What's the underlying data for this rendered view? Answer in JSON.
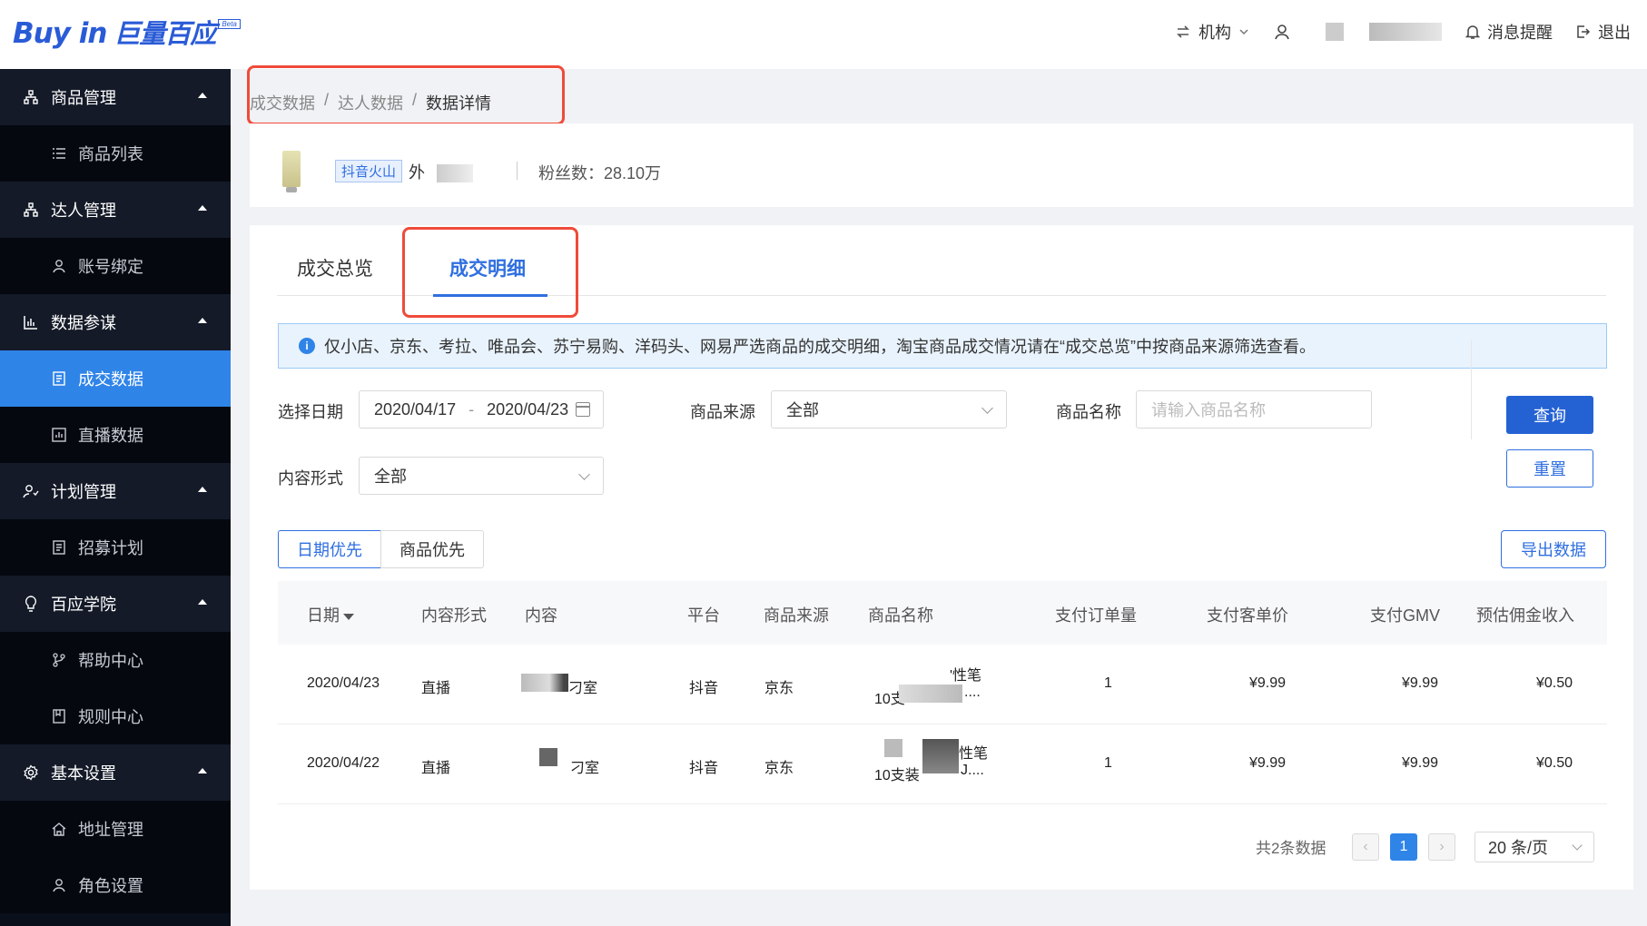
{
  "header": {
    "logo_en": "Buy in",
    "logo_cn": "巨量百应",
    "logo_badge": "Beta",
    "org_label": "机构",
    "notify_label": "消息提醒",
    "logout_label": "退出"
  },
  "sidebar": {
    "groups": [
      {
        "label": "商品管理",
        "icon": "hierarchy-icon",
        "items": [
          {
            "label": "商品列表",
            "icon": "list-icon"
          }
        ]
      },
      {
        "label": "达人管理",
        "icon": "hierarchy-icon",
        "items": [
          {
            "label": "账号绑定",
            "icon": "user-icon"
          }
        ]
      },
      {
        "label": "数据参谋",
        "icon": "bar-chart-icon",
        "items": [
          {
            "label": "成交数据",
            "icon": "document-icon",
            "active": true
          },
          {
            "label": "直播数据",
            "icon": "chart-box-icon"
          }
        ]
      },
      {
        "label": "计划管理",
        "icon": "user-plan-icon",
        "items": [
          {
            "label": "招募计划",
            "icon": "document-icon"
          }
        ]
      },
      {
        "label": "百应学院",
        "icon": "bulb-icon",
        "items": [
          {
            "label": "帮助中心",
            "icon": "branch-icon"
          },
          {
            "label": "规则中心",
            "icon": "book-icon"
          }
        ]
      },
      {
        "label": "基本设置",
        "icon": "gear-icon",
        "items": [
          {
            "label": "地址管理",
            "icon": "home-icon"
          },
          {
            "label": "角色设置",
            "icon": "user-icon"
          }
        ]
      }
    ]
  },
  "breadcrumb": {
    "items": [
      "成交数据",
      "达人数据",
      "数据详情"
    ]
  },
  "profile": {
    "platform_tag": "抖音火山",
    "name_prefix": "外",
    "fans": "粉丝数：28.10万"
  },
  "tabs": {
    "overview": "成交总览",
    "detail": "成交明细"
  },
  "notice": "仅小店、京东、考拉、唯品会、苏宁易购、洋码头、网易严选商品的成交明细，淘宝商品成交情况请在“成交总览”中按商品来源筛选查看。",
  "filters": {
    "date_label": "选择日期",
    "date_start": "2020/04/17",
    "date_sep": "-",
    "date_end": "2020/04/23",
    "source_label": "商品来源",
    "source_value": "全部",
    "name_label": "商品名称",
    "name_placeholder": "请输入商品名称",
    "content_label": "内容形式",
    "content_value": "全部",
    "query_btn": "查询",
    "reset_btn": "重置"
  },
  "sort": {
    "date_first": "日期优先",
    "product_first": "商品优先"
  },
  "export_btn": "导出数据",
  "table": {
    "columns": [
      "日期",
      "内容形式",
      "内容",
      "平台",
      "商品来源",
      "商品名称",
      "支付订单量",
      "支付客单价",
      "支付GMV",
      "预估佣金收入"
    ],
    "rows": [
      {
        "date": "2020/04/23",
        "form": "直播",
        "content": "刁室",
        "platform": "抖音",
        "source": "京东",
        "name_l1": "'性笔",
        "name_l2": "10支",
        "name_tail": "....",
        "orders": "1",
        "unit_price": "¥9.99",
        "gmv": "¥9.99",
        "commission": "¥0.50"
      },
      {
        "date": "2020/04/22",
        "form": "直播",
        "content": "刁室",
        "platform": "抖音",
        "source": "京东",
        "name_l1": "性笔",
        "name_l2": "10支装",
        "name_tail": "J....",
        "orders": "1",
        "unit_price": "¥9.99",
        "gmv": "¥9.99",
        "commission": "¥0.50"
      }
    ]
  },
  "pagination": {
    "total": "共2条数据",
    "current": "1",
    "page_size": "20 条/页"
  }
}
